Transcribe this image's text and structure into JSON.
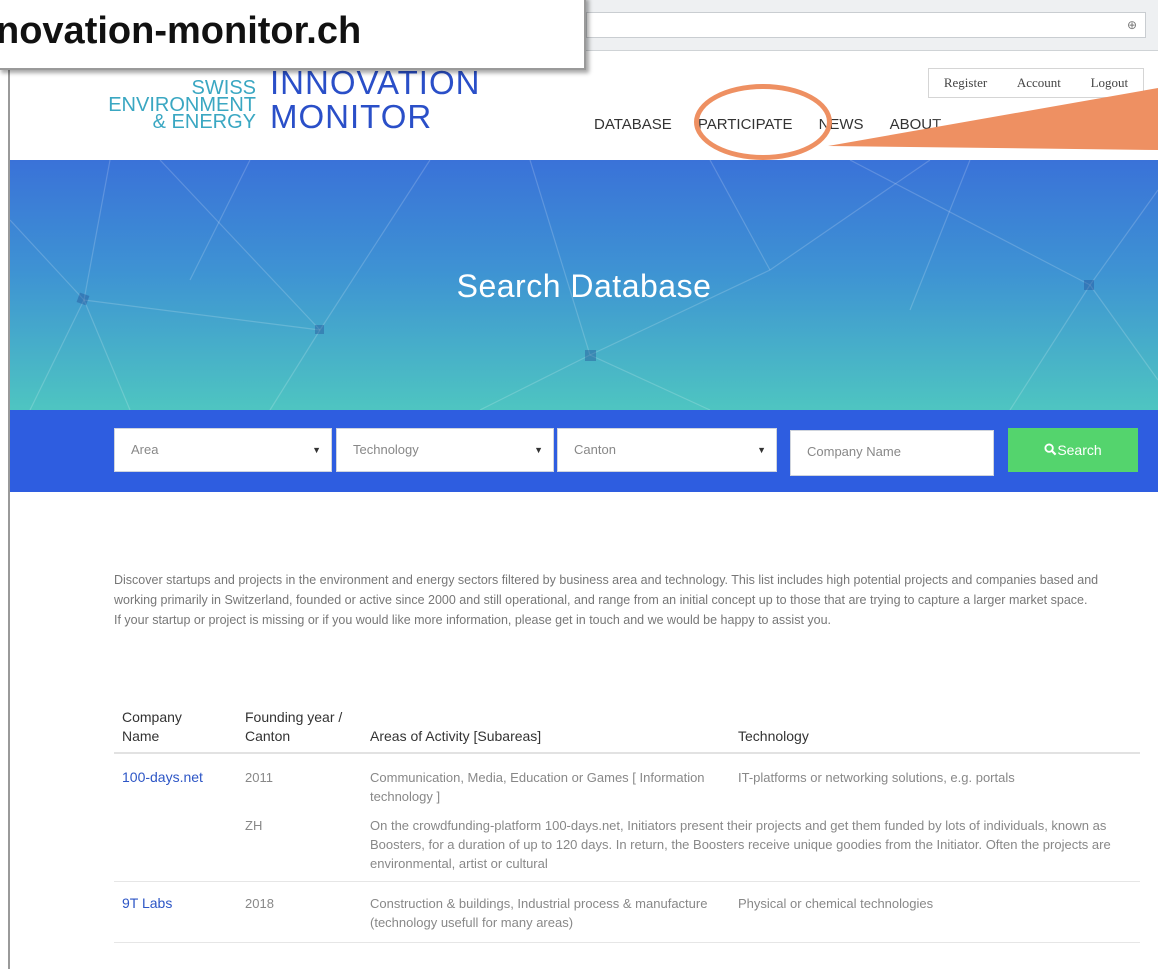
{
  "browser": {
    "zoom_icon": "magnifier-zoom-icon"
  },
  "callout": {
    "domain_text": "novation-monitor.ch"
  },
  "logo": {
    "small_lines": [
      "SWISS",
      "ENVIRONMENT",
      "& ENERGY"
    ],
    "big_lines": [
      "INNOVATION",
      "MONITOR"
    ]
  },
  "account_links": [
    "Register",
    "Account",
    "Logout"
  ],
  "nav": [
    "DATABASE",
    "PARTICIPATE",
    "NEWS",
    "ABOUT"
  ],
  "hero": {
    "title": "Search Database"
  },
  "search": {
    "area": "Area",
    "technology": "Technology",
    "canton": "Canton",
    "company_placeholder": "Company Name",
    "button_label": "Search",
    "button_icon": "search-icon"
  },
  "description": [
    "Discover startups and projects in the environment and energy sectors filtered by business area and technology. This list includes high potential projects and companies based and working primarily in Switzerland, founded or active since 2000 and still operational, and range from an initial concept up to those that are trying to capture a larger market space.",
    "If your startup or project is missing or if you would like more information, please get in touch and we would be happy to assist you."
  ],
  "table": {
    "headers": {
      "company": "Company Name",
      "founding": "Founding year / Canton",
      "areas": "Areas of Activity [Subareas]",
      "technology": "Technology"
    },
    "rows": [
      {
        "company": "100-days.net",
        "year": "2011",
        "areas": "Communication, Media, Education or Games [ Information technology ]",
        "technology": "IT-platforms or networking solutions, e.g. portals",
        "canton": "ZH",
        "description": "On the crowdfunding-platform 100-days.net, Initiators present their projects and get them funded by lots of individuals, known as Boosters, for a duration of up to 120 days. In return, the Boosters receive unique goodies from the Initiator. Often the projects are environmental, artist or cultural"
      },
      {
        "company": "9T Labs",
        "year": "2018",
        "areas": "Construction & buildings, Industrial process & manufacture (technology usefull for many areas)",
        "technology": "Physical or chemical technologies"
      }
    ]
  },
  "colors": {
    "brand_blue": "#2a4fc8",
    "logo_teal": "#3aa7c2",
    "search_band": "#2e5de0",
    "search_button": "#54d46d",
    "highlight_orange": "#ee9062"
  }
}
